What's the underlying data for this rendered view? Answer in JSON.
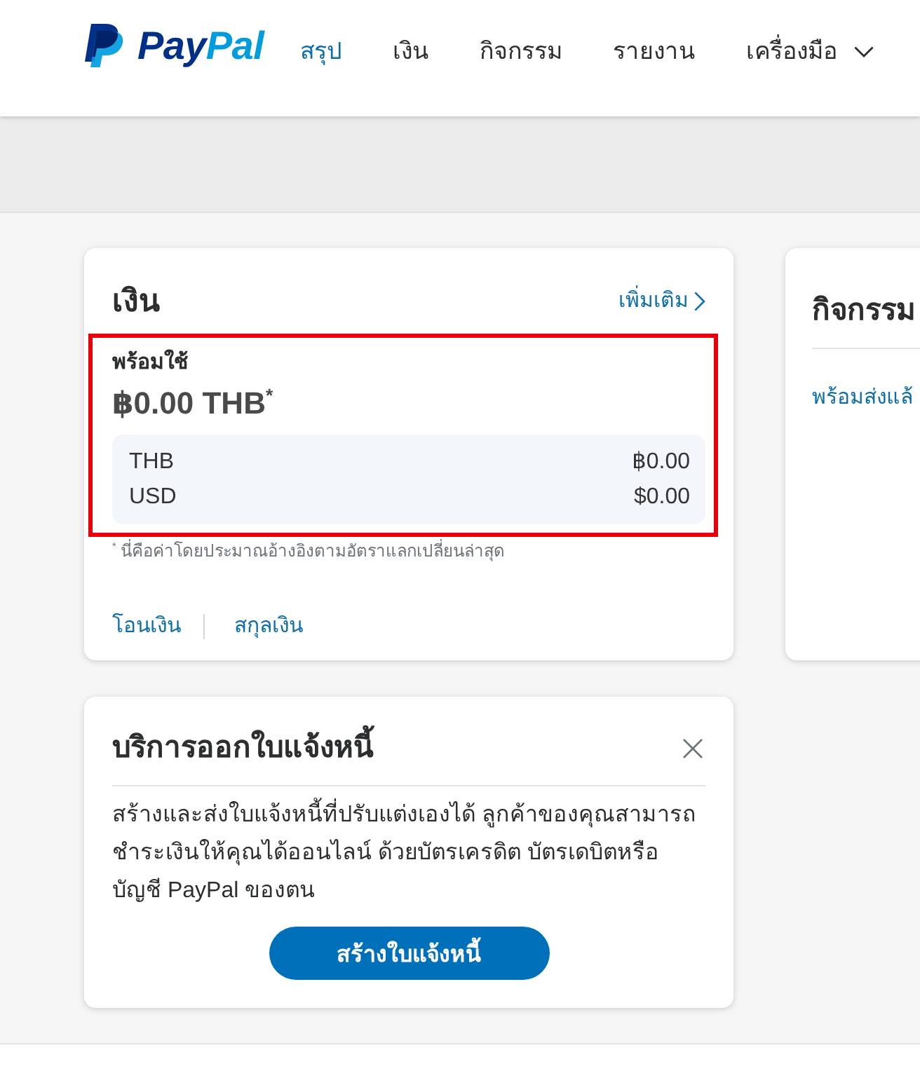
{
  "header": {
    "logo": {
      "wordmark": [
        {
          "text": "Pay",
          "color": "#003087"
        },
        {
          "text": "Pal",
          "color": "#009cde"
        }
      ]
    },
    "nav": [
      {
        "label": "สรุป",
        "selected": true,
        "dropdown": false
      },
      {
        "label": "เงิน",
        "selected": false,
        "dropdown": false
      },
      {
        "label": "กิจกรรม",
        "selected": false,
        "dropdown": false
      },
      {
        "label": "รายงาน",
        "selected": false,
        "dropdown": false
      },
      {
        "label": "เครื่องมือ",
        "selected": false,
        "dropdown": true
      }
    ]
  },
  "money_card": {
    "title": "เงิน",
    "more_link": "เพิ่มเติม",
    "highlighted": true,
    "available_label": "พร้อมใช้",
    "balance": "฿0.00 THB$^{*}$",
    "currencies": [
      {
        "code": "THB",
        "amount": "฿0.00"
      },
      {
        "code": "USD",
        "amount": "$0.00"
      }
    ],
    "footnote": "$^{*}$ นี่คือค่าโดยประมาณอ้างอิงตามอัตราแลกเปลี่ยนล่าสุด",
    "actions": [
      "โอนเงิน",
      "สกุลเงิน"
    ]
  },
  "activity_card": {
    "title": "กิจกรรม",
    "link": "พร้อมส่งแล้"
  },
  "invoice_card": {
    "title": "บริการออกใบแจ้งหนี้",
    "body": "สร้างและส่งใบแจ้งหนี้ที่ปรับแต่งเองได้ ลูกค้าของคุณสามารถชำระเงินให้คุณได้ออนไลน์ ด้วยบัตรเครดิต บัตรเดบิตหรือบัญชี PayPal ของตน",
    "button": "สร้างใบแจ้งหนี้"
  }
}
